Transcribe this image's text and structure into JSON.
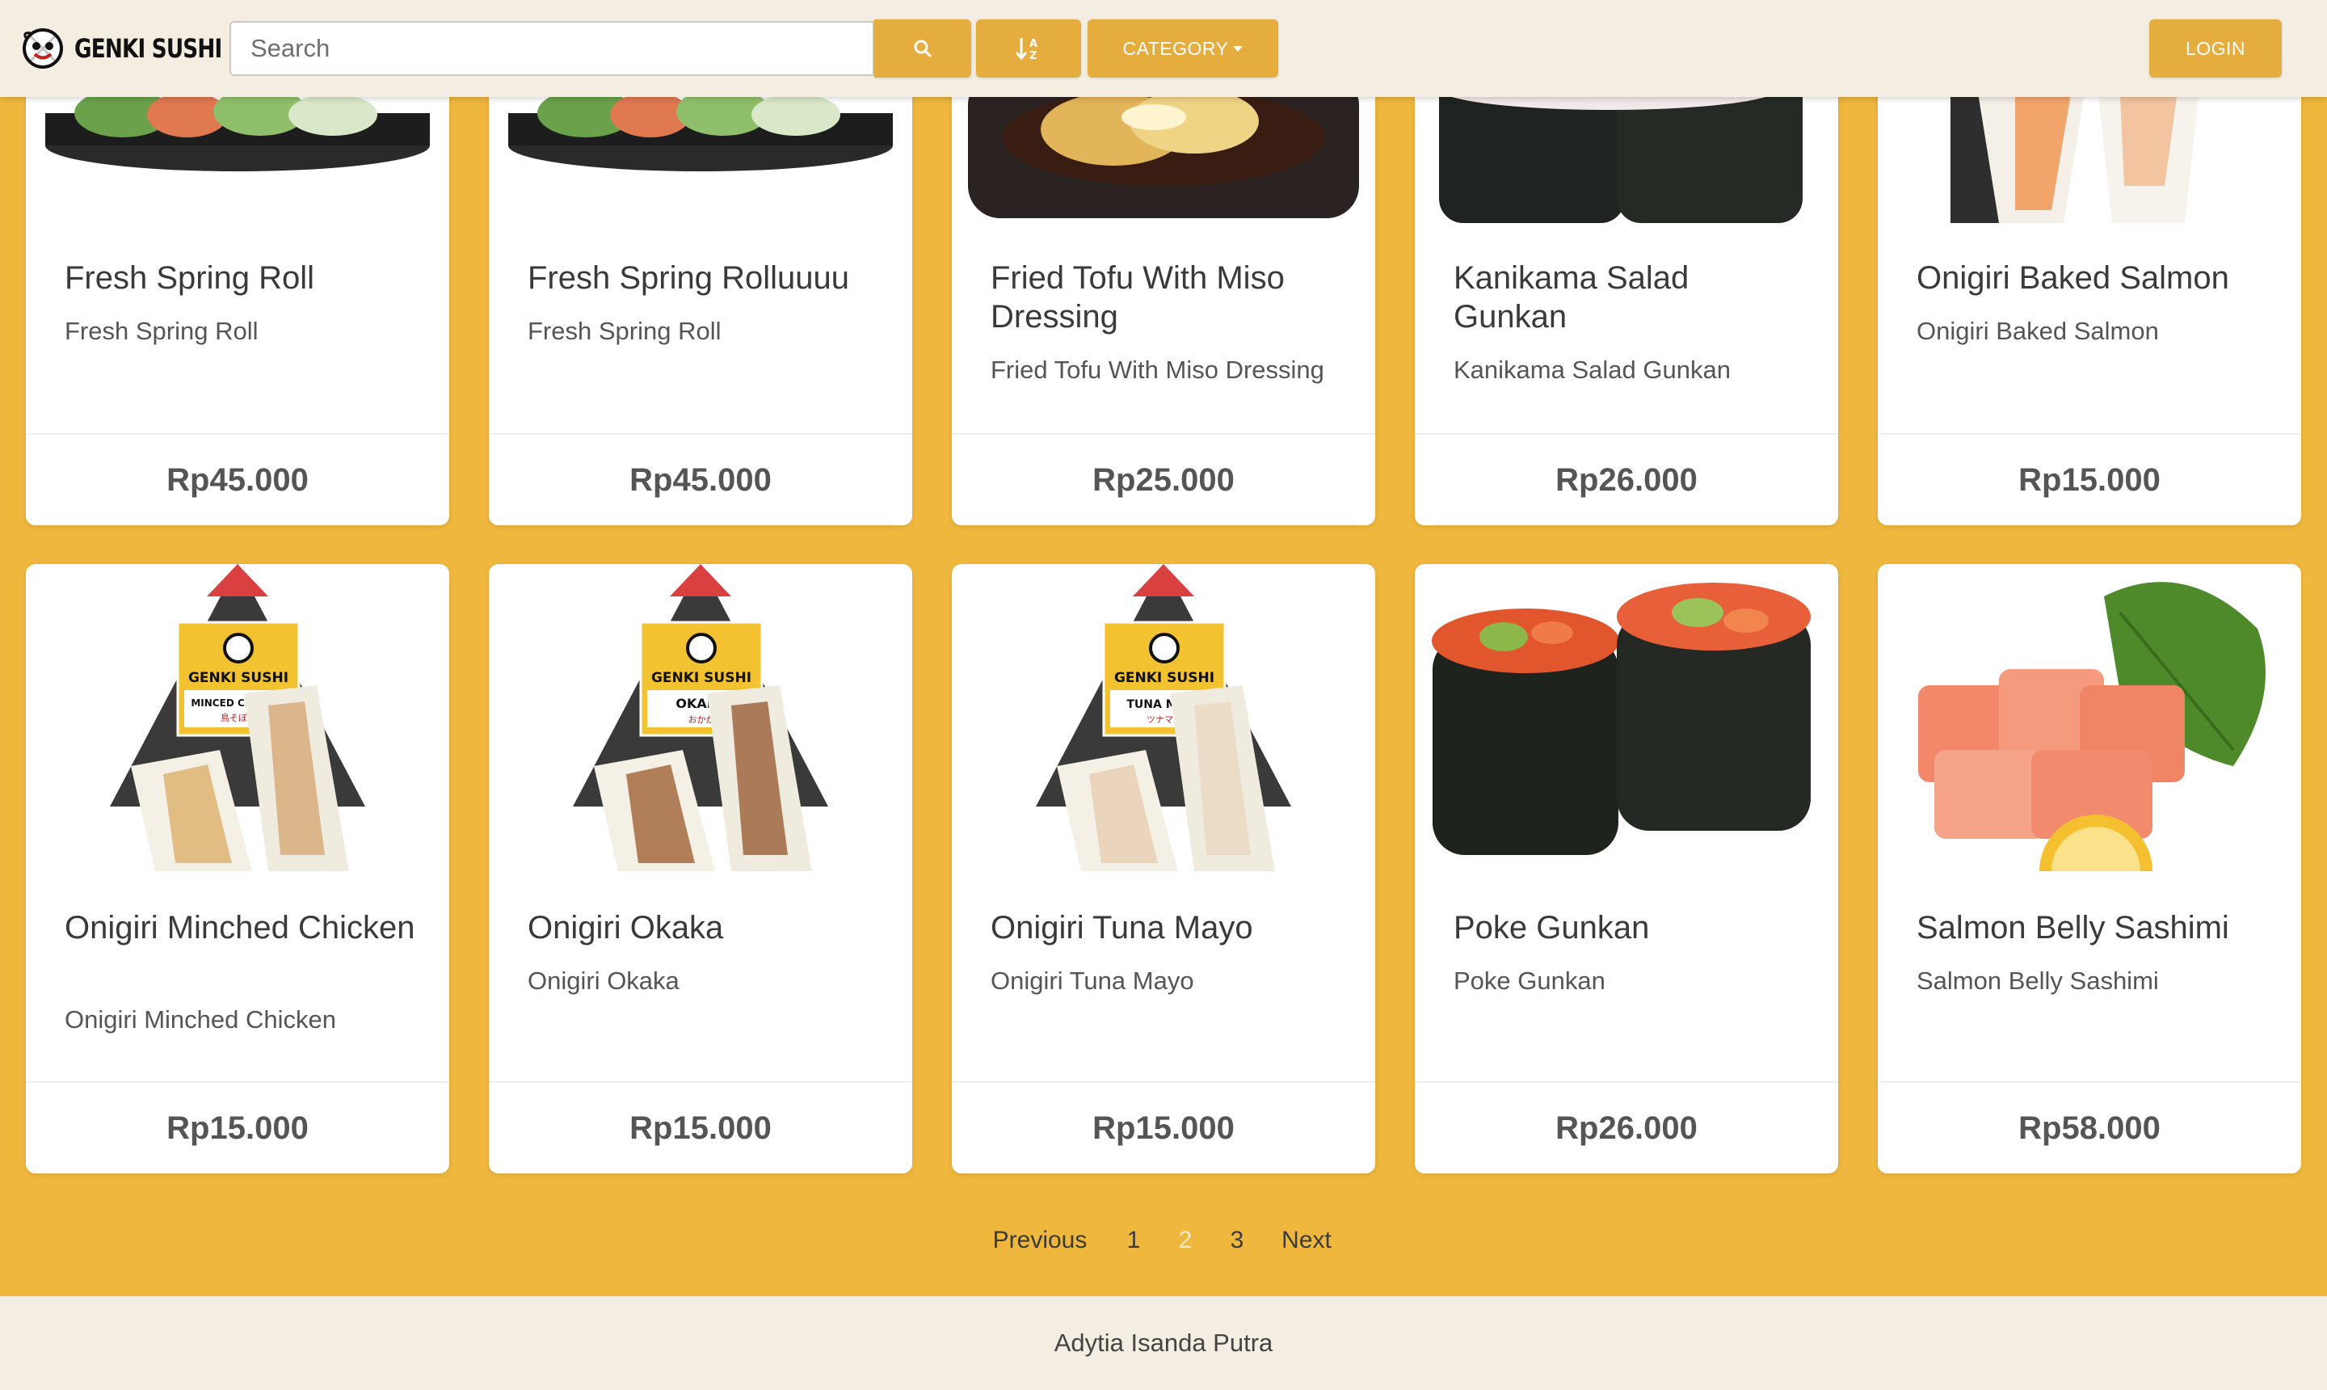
{
  "navbar": {
    "brand": "GENKI SUSHI",
    "search_placeholder": "Search",
    "category_label": "CATEGORY",
    "login_label": "LOGIN"
  },
  "products": [
    {
      "title": "Fresh Spring Roll",
      "description": "Fresh Spring Roll",
      "price": "Rp45.000",
      "image": "spring-roll-plate"
    },
    {
      "title": "Fresh Spring Rolluuuu",
      "description": "Fresh Spring Roll",
      "price": "Rp45.000",
      "image": "spring-roll-plate"
    },
    {
      "title": "Fried Tofu With Miso Dressing",
      "description": "Fried Tofu With Miso Dressing",
      "price": "Rp25.000",
      "image": "fried-tofu-plate"
    },
    {
      "title": "Kanikama Salad Gunkan",
      "description": "Kanikama Salad Gunkan",
      "price": "Rp26.000",
      "image": "gunkan-kanikama"
    },
    {
      "title": "Onigiri Baked Salmon",
      "description": "Onigiri Baked Salmon",
      "price": "Rp15.000",
      "image": "onigiri-salmon"
    },
    {
      "title": "Onigiri Minched Chicken",
      "description": "Onigiri Minched Chicken",
      "price": "Rp15.000",
      "image": "onigiri-package",
      "package_brand": "GENKI SUSHI",
      "package_label": "MINCED CHICKEN",
      "package_sub": "鳥そぼろ"
    },
    {
      "title": "Onigiri Okaka",
      "description": "Onigiri Okaka",
      "price": "Rp15.000",
      "image": "onigiri-package",
      "package_brand": "GENKI SUSHI",
      "package_label": "OKAKA",
      "package_sub": "おかか"
    },
    {
      "title": "Onigiri Tuna Mayo",
      "description": "Onigiri Tuna Mayo",
      "price": "Rp15.000",
      "image": "onigiri-package",
      "package_brand": "GENKI SUSHI",
      "package_label": "TUNA MAYO",
      "package_sub": "ツナマヨ"
    },
    {
      "title": "Poke Gunkan",
      "description": "Poke Gunkan",
      "price": "Rp26.000",
      "image": "gunkan-poke"
    },
    {
      "title": "Salmon Belly Sashimi",
      "description": "Salmon Belly Sashimi",
      "price": "Rp58.000",
      "image": "salmon-sashimi"
    }
  ],
  "pagination": {
    "previous": "Previous",
    "pages": [
      "1",
      "2",
      "3"
    ],
    "current": "2",
    "next": "Next"
  },
  "footer": {
    "text": "Adytia Isanda Putra"
  },
  "colors": {
    "accent": "#e5ac3e",
    "background": "#efb73e",
    "navbar": "#f4ede2"
  }
}
